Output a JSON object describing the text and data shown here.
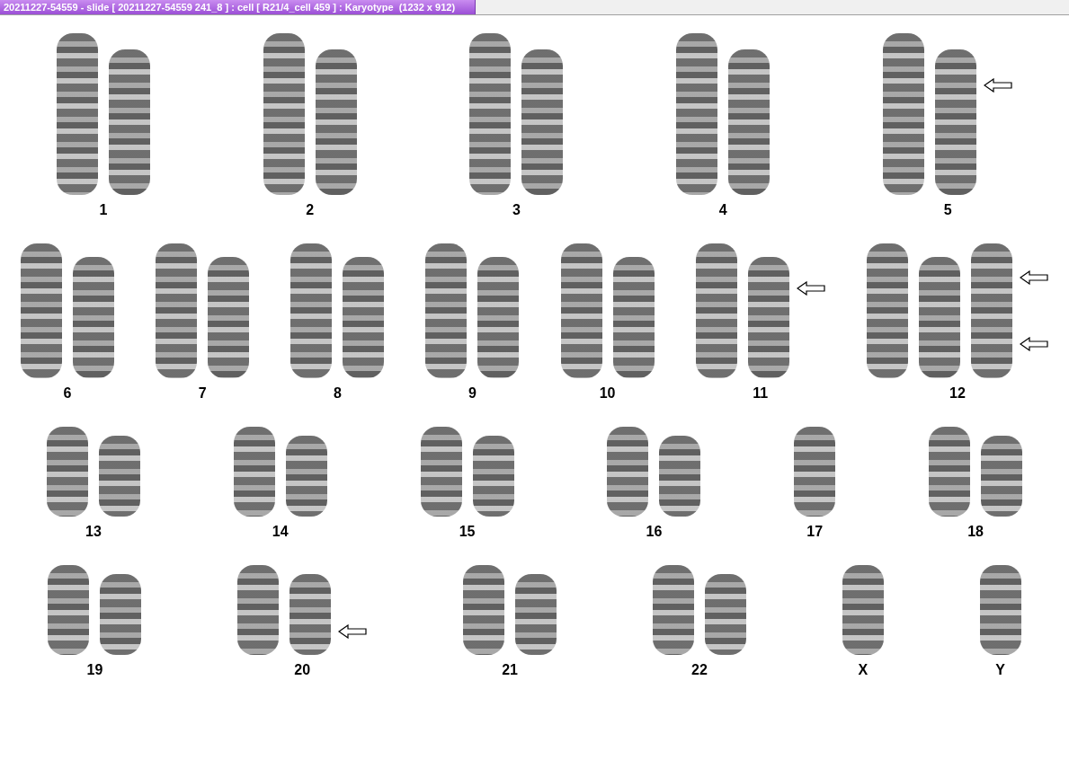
{
  "window": {
    "title": "20211227-54559 - slide [ 20211227-54559 241_8 ] : cell [ R21/4_cell 459 ] : Karyotype  (1232 x 912)"
  },
  "rows": [
    {
      "groups": [
        {
          "label": "1",
          "chromosomes": [
            {
              "arrow_upper": false,
              "arrow_lower": false
            },
            {
              "arrow_upper": false,
              "arrow_lower": false
            }
          ]
        },
        {
          "label": "2",
          "chromosomes": [
            {
              "arrow_upper": false,
              "arrow_lower": false
            },
            {
              "arrow_upper": false,
              "arrow_lower": false
            }
          ]
        },
        {
          "label": "3",
          "chromosomes": [
            {
              "arrow_upper": false,
              "arrow_lower": false
            },
            {
              "arrow_upper": false,
              "arrow_lower": false
            }
          ]
        },
        {
          "label": "4",
          "chromosomes": [
            {
              "arrow_upper": false,
              "arrow_lower": false
            },
            {
              "arrow_upper": false,
              "arrow_lower": false
            }
          ]
        },
        {
          "label": "5",
          "chromosomes": [
            {
              "arrow_upper": false,
              "arrow_lower": false
            },
            {
              "arrow_upper": true,
              "arrow_lower": false
            }
          ]
        }
      ]
    },
    {
      "groups": [
        {
          "label": "6",
          "chromosomes": [
            {
              "arrow_upper": false,
              "arrow_lower": false
            },
            {
              "arrow_upper": false,
              "arrow_lower": false
            }
          ]
        },
        {
          "label": "7",
          "chromosomes": [
            {
              "arrow_upper": false,
              "arrow_lower": false
            },
            {
              "arrow_upper": false,
              "arrow_lower": false
            }
          ]
        },
        {
          "label": "8",
          "chromosomes": [
            {
              "arrow_upper": false,
              "arrow_lower": false
            },
            {
              "arrow_upper": false,
              "arrow_lower": false
            }
          ]
        },
        {
          "label": "9",
          "chromosomes": [
            {
              "arrow_upper": false,
              "arrow_lower": false
            },
            {
              "arrow_upper": false,
              "arrow_lower": false
            }
          ]
        },
        {
          "label": "10",
          "chromosomes": [
            {
              "arrow_upper": false,
              "arrow_lower": false
            },
            {
              "arrow_upper": false,
              "arrow_lower": false
            }
          ]
        },
        {
          "label": "11",
          "chromosomes": [
            {
              "arrow_upper": false,
              "arrow_lower": false
            },
            {
              "arrow_upper": true,
              "arrow_lower": false
            }
          ]
        },
        {
          "label": "12",
          "chromosomes": [
            {
              "arrow_upper": false,
              "arrow_lower": false
            },
            {
              "arrow_upper": false,
              "arrow_lower": false
            },
            {
              "arrow_upper": true,
              "arrow_lower": true
            }
          ]
        }
      ]
    },
    {
      "groups": [
        {
          "label": "13",
          "chromosomes": [
            {
              "arrow_upper": false,
              "arrow_lower": false
            },
            {
              "arrow_upper": false,
              "arrow_lower": false
            }
          ]
        },
        {
          "label": "14",
          "chromosomes": [
            {
              "arrow_upper": false,
              "arrow_lower": false
            },
            {
              "arrow_upper": false,
              "arrow_lower": false
            }
          ]
        },
        {
          "label": "15",
          "chromosomes": [
            {
              "arrow_upper": false,
              "arrow_lower": false
            },
            {
              "arrow_upper": false,
              "arrow_lower": false
            }
          ]
        },
        {
          "label": "16",
          "chromosomes": [
            {
              "arrow_upper": false,
              "arrow_lower": false
            },
            {
              "arrow_upper": false,
              "arrow_lower": false
            }
          ]
        },
        {
          "label": "17",
          "chromosomes": [
            {
              "arrow_upper": false,
              "arrow_lower": false
            }
          ]
        },
        {
          "label": "18",
          "chromosomes": [
            {
              "arrow_upper": false,
              "arrow_lower": false
            },
            {
              "arrow_upper": false,
              "arrow_lower": false
            }
          ]
        }
      ]
    },
    {
      "groups": [
        {
          "label": "19",
          "chromosomes": [
            {
              "arrow_upper": false,
              "arrow_lower": false
            },
            {
              "arrow_upper": false,
              "arrow_lower": false
            }
          ]
        },
        {
          "label": "20",
          "chromosomes": [
            {
              "arrow_upper": false,
              "arrow_lower": false
            },
            {
              "arrow_upper": false,
              "arrow_lower": true
            }
          ]
        },
        {
          "label": "21",
          "chromosomes": [
            {
              "arrow_upper": false,
              "arrow_lower": false
            },
            {
              "arrow_upper": false,
              "arrow_lower": false
            }
          ]
        },
        {
          "label": "22",
          "chromosomes": [
            {
              "arrow_upper": false,
              "arrow_lower": false
            },
            {
              "arrow_upper": false,
              "arrow_lower": false
            }
          ]
        },
        {
          "label": "X",
          "chromosomes": [
            {
              "arrow_upper": false,
              "arrow_lower": false
            }
          ]
        },
        {
          "label": "Y",
          "chromosomes": [
            {
              "arrow_upper": false,
              "arrow_lower": false
            }
          ]
        }
      ]
    }
  ]
}
